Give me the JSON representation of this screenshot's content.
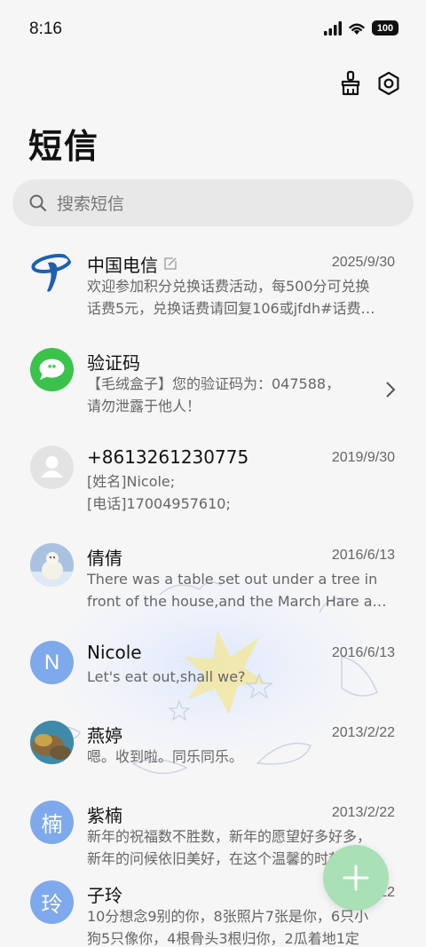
{
  "status_bar": {
    "time": "8:16",
    "battery": "100"
  },
  "header": {
    "title": "短信"
  },
  "search": {
    "placeholder": "搜索短信"
  },
  "messages": [
    {
      "name": "中国电信",
      "date": "2025/9/30",
      "line1": "欢迎参加积分兑换话费活动，每500分可兑换",
      "line2": "话费5元，兑换话费请回复106或jfdh#话费…",
      "avatar": "china-telecom-logo"
    },
    {
      "name": "验证码",
      "date": "",
      "line1": "【毛绒盒子】您的验证码为：047588，",
      "line2": "请勿泄露于他人！",
      "avatar": "message-bubble-icon"
    },
    {
      "name": "+8613261230775",
      "date": "2019/9/30",
      "line1": "[姓名]Nicole;",
      "line2": "[电话]17004957610;",
      "avatar": "person-icon"
    },
    {
      "name": "倩倩",
      "date": "2016/6/13",
      "line1": "There was a table set out under a tree in",
      "line2": "front of the house,and the March Hare an…",
      "avatar": "polar-bear-photo"
    },
    {
      "name": "Nicole",
      "date": "2016/6/13",
      "line1": "Let's eat out,shall we?",
      "line2": "",
      "avatar_letter": "N",
      "avatar_color": "#7ea9ec"
    },
    {
      "name": "燕婷",
      "date": "2013/2/22",
      "line1": "嗯。收到啦。同乐同乐。",
      "line2": "",
      "avatar": "landscape-photo"
    },
    {
      "name": "紫楠",
      "date": "2013/2/22",
      "line1": "新年的祝福数不胜数，新年的愿望好多好多，",
      "line2": "新年的问候依旧美好，在这个温馨的时刻…",
      "avatar_letter": "楠",
      "avatar_color": "#7ea9ec"
    },
    {
      "name": "子玲",
      "date": "2013/2/22",
      "line1": "10分想念9别的你，8张照片7张是你，6只小",
      "line2": "狗5只像你，4根骨头3根归你，2瓜着地1定",
      "avatar_letter": "玲",
      "avatar_color": "#7ea9ec"
    }
  ],
  "colors": {
    "accent_green": "#3bc24b",
    "fab": "#a9e0b6",
    "letter_avatar": "#7ea9ec",
    "telecom_blue": "#1f5fb0"
  }
}
